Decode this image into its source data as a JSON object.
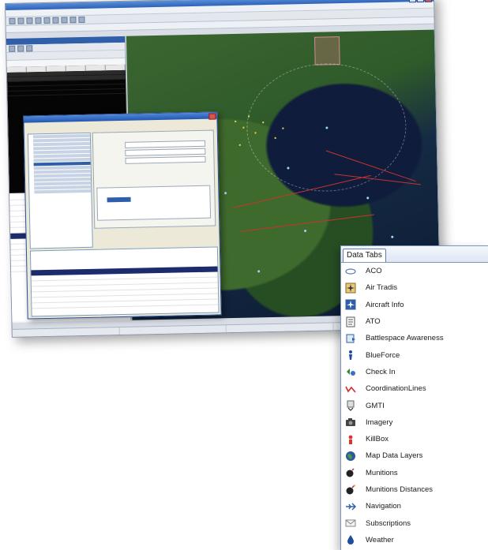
{
  "data_tabs": {
    "title": "Data Tabs",
    "items": [
      {
        "label": "ACO",
        "icon": "aco-oval-icon"
      },
      {
        "label": "Air Tradis",
        "icon": "aircraft-track-icon"
      },
      {
        "label": "Aircraft Info",
        "icon": "aircraft-info-icon"
      },
      {
        "label": "ATO",
        "icon": "ato-document-icon"
      },
      {
        "label": "Battlespace Awareness",
        "icon": "battlespace-icon"
      },
      {
        "label": "BlueForce",
        "icon": "blueforce-soldier-icon"
      },
      {
        "label": "Check In",
        "icon": "check-in-icon"
      },
      {
        "label": "CoordinationLines",
        "icon": "coordination-lines-icon"
      },
      {
        "label": "GMTI",
        "icon": "gmti-radar-icon"
      },
      {
        "label": "Imagery",
        "icon": "imagery-camera-icon"
      },
      {
        "label": "KillBox",
        "icon": "killbox-icon"
      },
      {
        "label": "Map Data Layers",
        "icon": "map-globe-icon"
      },
      {
        "label": "Munitions",
        "icon": "munitions-bomb-icon"
      },
      {
        "label": "Munitions Distances",
        "icon": "munitions-distances-icon"
      },
      {
        "label": "Navigation",
        "icon": "navigation-plane-icon"
      },
      {
        "label": "Subscriptions",
        "icon": "subscriptions-icon"
      },
      {
        "label": "Weather",
        "icon": "weather-drop-icon"
      }
    ]
  },
  "colors": {
    "titlebar": "#2d62b8",
    "dialog_title": "#2257b0",
    "selection": "#1b2b6b",
    "map_land": "#3c6630",
    "map_sea": "#0d1a33",
    "coordination_line": "#c9342d",
    "panel_border": "#7b96bf"
  }
}
